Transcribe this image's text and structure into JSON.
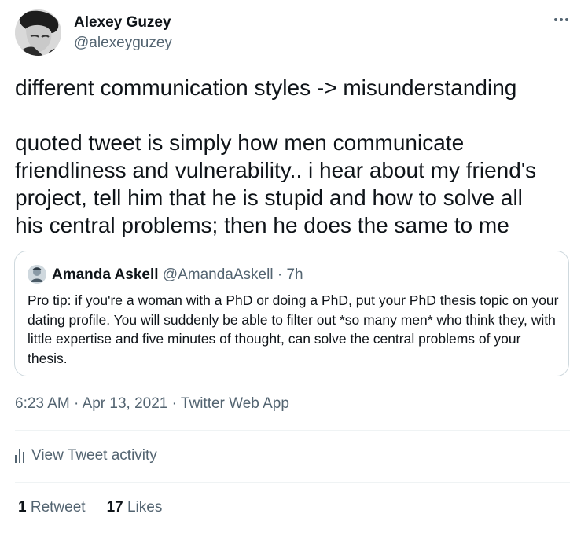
{
  "author": {
    "name": "Alexey Guzey",
    "handle": "@alexeyguzey"
  },
  "tweet": {
    "text": "different communication styles -> misunderstanding\n\nquoted tweet is simply how men communicate\nfriendliness and vulnerability.. i hear about my friend's\nproject, tell him that he is stupid and how to solve all\nhis central problems; then he does the same to me"
  },
  "quoted_tweet": {
    "name": "Amanda Askell",
    "handle": "@AmandaAskell",
    "separator": "·",
    "time": "7h",
    "text": "Pro tip: if you're a woman with a PhD or doing a PhD, put your PhD thesis topic on your dating profile. You will suddenly be able to filter out *so many men* who think they, with little expertise and five minutes of thought, can solve the central problems of your thesis."
  },
  "meta": {
    "time": "6:23 AM",
    "date": "Apr 13, 2021",
    "separator": "·",
    "source": "Twitter Web App"
  },
  "activity": {
    "label": "View Tweet activity",
    "icon": "bar-chart-icon"
  },
  "stats": {
    "retweets_count": "1",
    "retweets_label": "Retweet",
    "likes_count": "17",
    "likes_label": "Likes"
  },
  "icons": {
    "more": "more-horizontal-icon"
  },
  "colors": {
    "text_primary": "#0f1419",
    "text_secondary": "#536471",
    "border": "#cfd9de",
    "divider": "#eff3f4"
  }
}
